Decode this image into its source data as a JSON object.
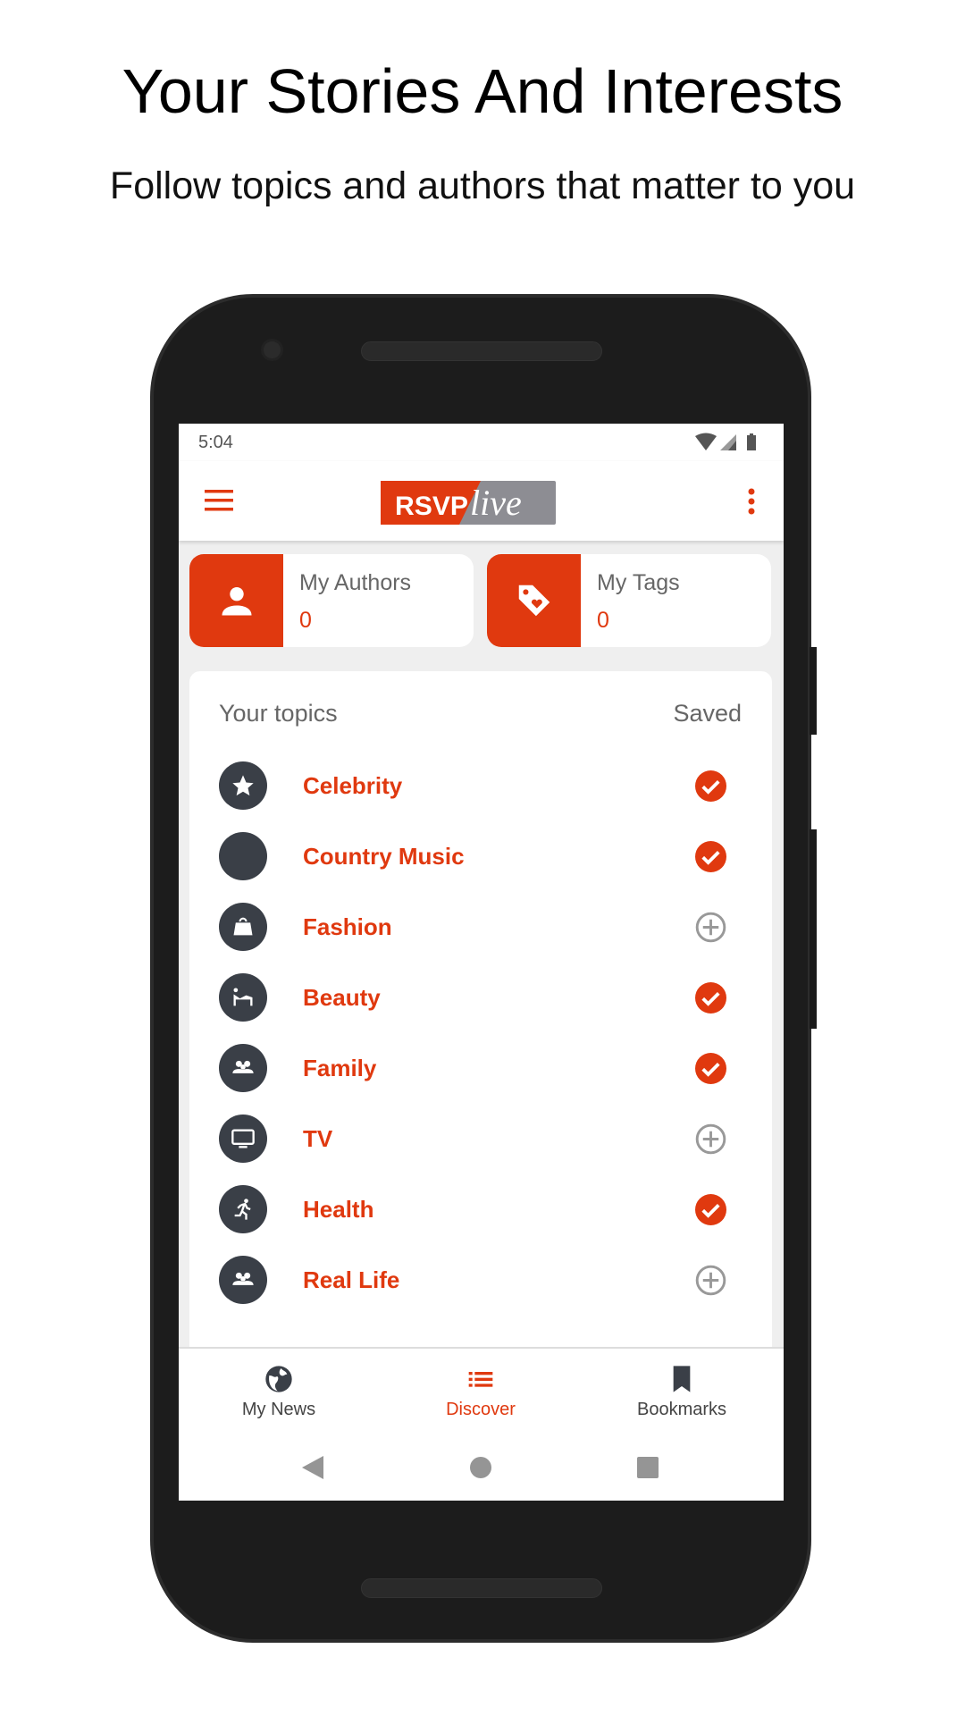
{
  "headline": "Your Stories And Interests",
  "subheadline": "Follow topics and authors that matter to you",
  "status_bar": {
    "time": "5:04"
  },
  "app_bar": {
    "logo_text": "RSVP live",
    "logo_part1": "RSVP",
    "logo_part2": "live"
  },
  "colors": {
    "accent": "#E0390F",
    "icon_bg": "#3A3F47",
    "text_gray": "#666666"
  },
  "cards": [
    {
      "label": "My Authors",
      "value": "0",
      "icon": "person-icon"
    },
    {
      "label": "My Tags",
      "value": "0",
      "icon": "tag-heart-icon"
    }
  ],
  "topics": {
    "header": "Your topics",
    "saved_header": "Saved",
    "items": [
      {
        "name": "Celebrity",
        "icon": "star-icon",
        "saved": true
      },
      {
        "name": "Country Music",
        "icon": "blank-icon",
        "saved": true
      },
      {
        "name": "Fashion",
        "icon": "shopping-bag-icon",
        "saved": false
      },
      {
        "name": "Beauty",
        "icon": "spa-icon",
        "saved": true
      },
      {
        "name": "Family",
        "icon": "people-icon",
        "saved": true
      },
      {
        "name": "TV",
        "icon": "tv-icon",
        "saved": false
      },
      {
        "name": "Health",
        "icon": "running-icon",
        "saved": true
      },
      {
        "name": "Real Life",
        "icon": "people-icon",
        "saved": false
      }
    ]
  },
  "bottom_nav": [
    {
      "label": "My News",
      "icon": "globe-icon",
      "active": false
    },
    {
      "label": "Discover",
      "icon": "list-icon",
      "active": true
    },
    {
      "label": "Bookmarks",
      "icon": "bookmark-icon",
      "active": false
    }
  ]
}
